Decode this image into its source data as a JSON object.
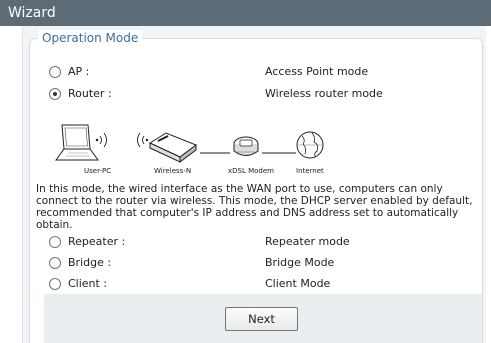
{
  "window": {
    "title": "Wizard"
  },
  "section": {
    "legend": "Operation Mode"
  },
  "modes_top": [
    {
      "label": "AP :",
      "description": "Access Point mode",
      "selected": false
    },
    {
      "label": "Router :",
      "description": "Wireless router mode",
      "selected": true
    }
  ],
  "diagram": {
    "labels": [
      "User-PC",
      "Wireless-N",
      "xDSL Modem",
      "Internet"
    ]
  },
  "router_description": "In this mode, the wired interface as the WAN port to use, computers can only connect to the router via wireless. This mode, the DHCP server enabled by default, recommended that computer's IP address and DNS address set to automatically obtain.",
  "modes_bottom": [
    {
      "label": "Repeater :",
      "description": "Repeater mode",
      "selected": false
    },
    {
      "label": "Bridge :",
      "description": "Bridge Mode",
      "selected": false
    },
    {
      "label": "Client :",
      "description": "Client Mode",
      "selected": false
    }
  ],
  "footer": {
    "next_label": "Next"
  },
  "colors": {
    "title_bar": "#5c6b76",
    "legend_text": "#3f6d9a",
    "content_bg": "#f1f5f8",
    "footer_bg": "#e9eef1"
  }
}
